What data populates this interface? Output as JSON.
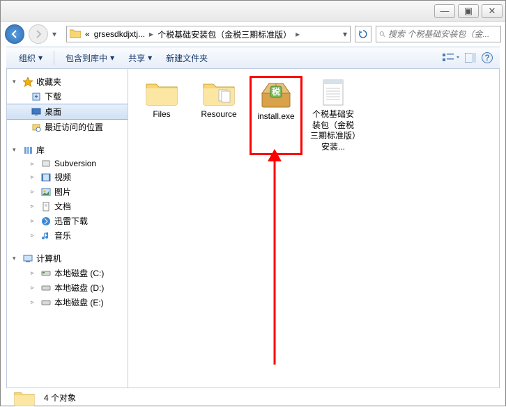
{
  "titlebar": {
    "min": "—",
    "max": "▣",
    "close": "✕"
  },
  "breadcrumb": {
    "prefix": "«",
    "parts": [
      "grsesdkdjxtj...",
      "个税基础安装包（金税三期标准版）"
    ]
  },
  "search": {
    "placeholder": "搜索 个税基础安装包（金..."
  },
  "toolbar": {
    "organize": "组织",
    "include": "包含到库中",
    "share": "共享",
    "newfolder": "新建文件夹"
  },
  "sidebar": {
    "favorites": {
      "label": "收藏夹",
      "items": [
        "下载",
        "桌面",
        "最近访问的位置"
      ]
    },
    "libraries": {
      "label": "库",
      "items": [
        "Subversion",
        "视频",
        "图片",
        "文档",
        "迅雷下载",
        "音乐"
      ]
    },
    "computer": {
      "label": "计算机",
      "items": [
        "本地磁盘 (C:)",
        "本地磁盘 (D:)",
        "本地磁盘 (E:)"
      ]
    }
  },
  "files": [
    {
      "name": "Files",
      "type": "folder"
    },
    {
      "name": "Resource",
      "type": "folder"
    },
    {
      "name": "install.exe",
      "type": "installer",
      "highlight": true
    },
    {
      "name": "个税基础安装包（金税三期标准版）安装...",
      "type": "text"
    }
  ],
  "status": {
    "count": "4 个对象"
  }
}
